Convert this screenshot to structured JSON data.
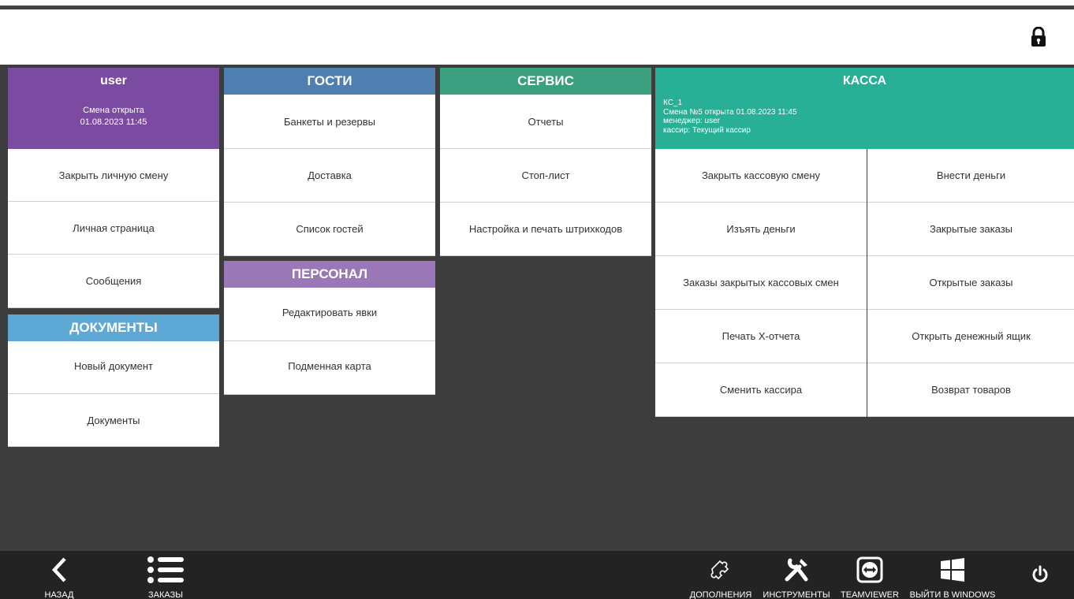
{
  "user_panel": {
    "name": "user",
    "shift_status": "Смена открыта",
    "shift_time": "01.08.2023 11:45",
    "items": [
      "Закрыть личную смену",
      "Личная страница",
      "Сообщения"
    ]
  },
  "documents": {
    "title": "ДОКУМЕНТЫ",
    "items": [
      "Новый документ",
      "Документы"
    ]
  },
  "guests": {
    "title": "ГОСТИ",
    "items": [
      "Банкеты и резервы",
      "Доставка",
      "Список гостей"
    ]
  },
  "staff": {
    "title": "ПЕРСОНАЛ",
    "items": [
      "Редактировать явки",
      "Подменная карта"
    ]
  },
  "service": {
    "title": "СЕРВИС",
    "items": [
      "Отчеты",
      "Стоп-лист",
      "Настройка и печать штрихкодов"
    ]
  },
  "kassa": {
    "title": "КАССА",
    "info": [
      "КС_1",
      "Смена №5 открыта 01.08.2023 11:45",
      "менеджер: user",
      "кассир: Текущий кассир"
    ],
    "items": [
      "Закрыть кассовую смену",
      "Внести деньги",
      "Изъять деньги",
      "Закрытые заказы",
      "Заказы закрытых кассовых смен",
      "Открытые заказы",
      "Печать X-отчета",
      "Открыть денежный ящик",
      "Сменить кассира",
      "Возврат товаров"
    ]
  },
  "bottom": {
    "back": "НАЗАД",
    "orders": "ЗАКАЗЫ",
    "addons": "ДОПОЛНЕНИЯ",
    "tools": "ИНСТРУМЕНТЫ",
    "teamviewer": "TEAMVIEWER",
    "windows": "ВЫЙТИ В WINDOWS"
  },
  "colors": {
    "user": "#7b4aa1",
    "documents": "#5ea8d6",
    "guests": "#4f7fb0",
    "staff": "#9a78b7",
    "service": "#3aa07f",
    "kassa": "#27b096"
  },
  "icons": [
    "lock-icon",
    "back-icon",
    "list-icon",
    "puzzle-icon",
    "tools-icon",
    "teamviewer-icon",
    "windows-icon",
    "power-icon"
  ]
}
